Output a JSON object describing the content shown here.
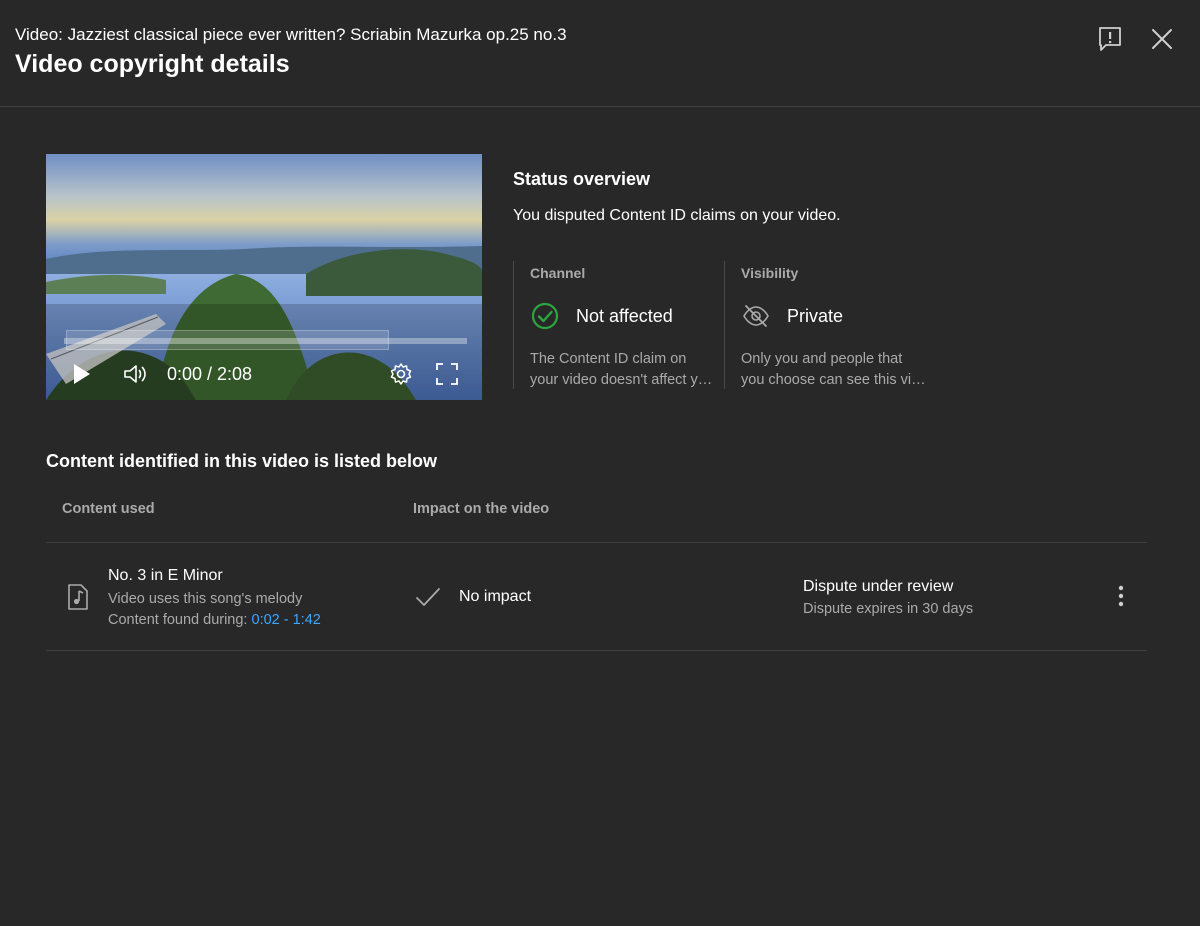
{
  "header": {
    "video_line": "Video: Jazziest classical piece ever written? Scriabin Mazurka op.25 no.3",
    "title": "Video copyright details",
    "feedback_icon": "feedback-icon",
    "close_icon": "close-icon"
  },
  "player": {
    "time": "0:00 / 2:08",
    "progress_fraction": 0,
    "icons": [
      "play-icon",
      "volume-icon",
      "settings-gear-icon",
      "fullscreen-icon"
    ]
  },
  "status": {
    "title": "Status overview",
    "description": "You disputed Content ID claims on your video.",
    "cards": [
      {
        "label": "Channel",
        "value": "Not affected",
        "icon": "check-circle-icon",
        "icon_color": "#2ba640",
        "desc_line1": "The Content ID claim on",
        "desc_line2": "your video doesn't affect your channel."
      },
      {
        "label": "Visibility",
        "value": "Private",
        "icon": "eye-off-icon",
        "desc_line1": "Only you and people that",
        "desc_line2": "you choose can see this video."
      }
    ]
  },
  "content": {
    "section_title": "Content identified in this video is listed below",
    "columns": [
      "Content used",
      "Impact on the video"
    ],
    "rows": [
      {
        "title": "No. 3 in E Minor",
        "usage": "Video uses this song's melody",
        "found_prefix": "Content found during: ",
        "found_range": "0:02 - 1:42",
        "impact": "No impact",
        "dispute_status": "Dispute under review",
        "dispute_expiry": "Dispute expires in 30 days"
      }
    ]
  },
  "colors": {
    "background": "#282828",
    "link": "#3ea6ff",
    "success": "#2ba640",
    "secondary_text": "#aaaaaa"
  }
}
